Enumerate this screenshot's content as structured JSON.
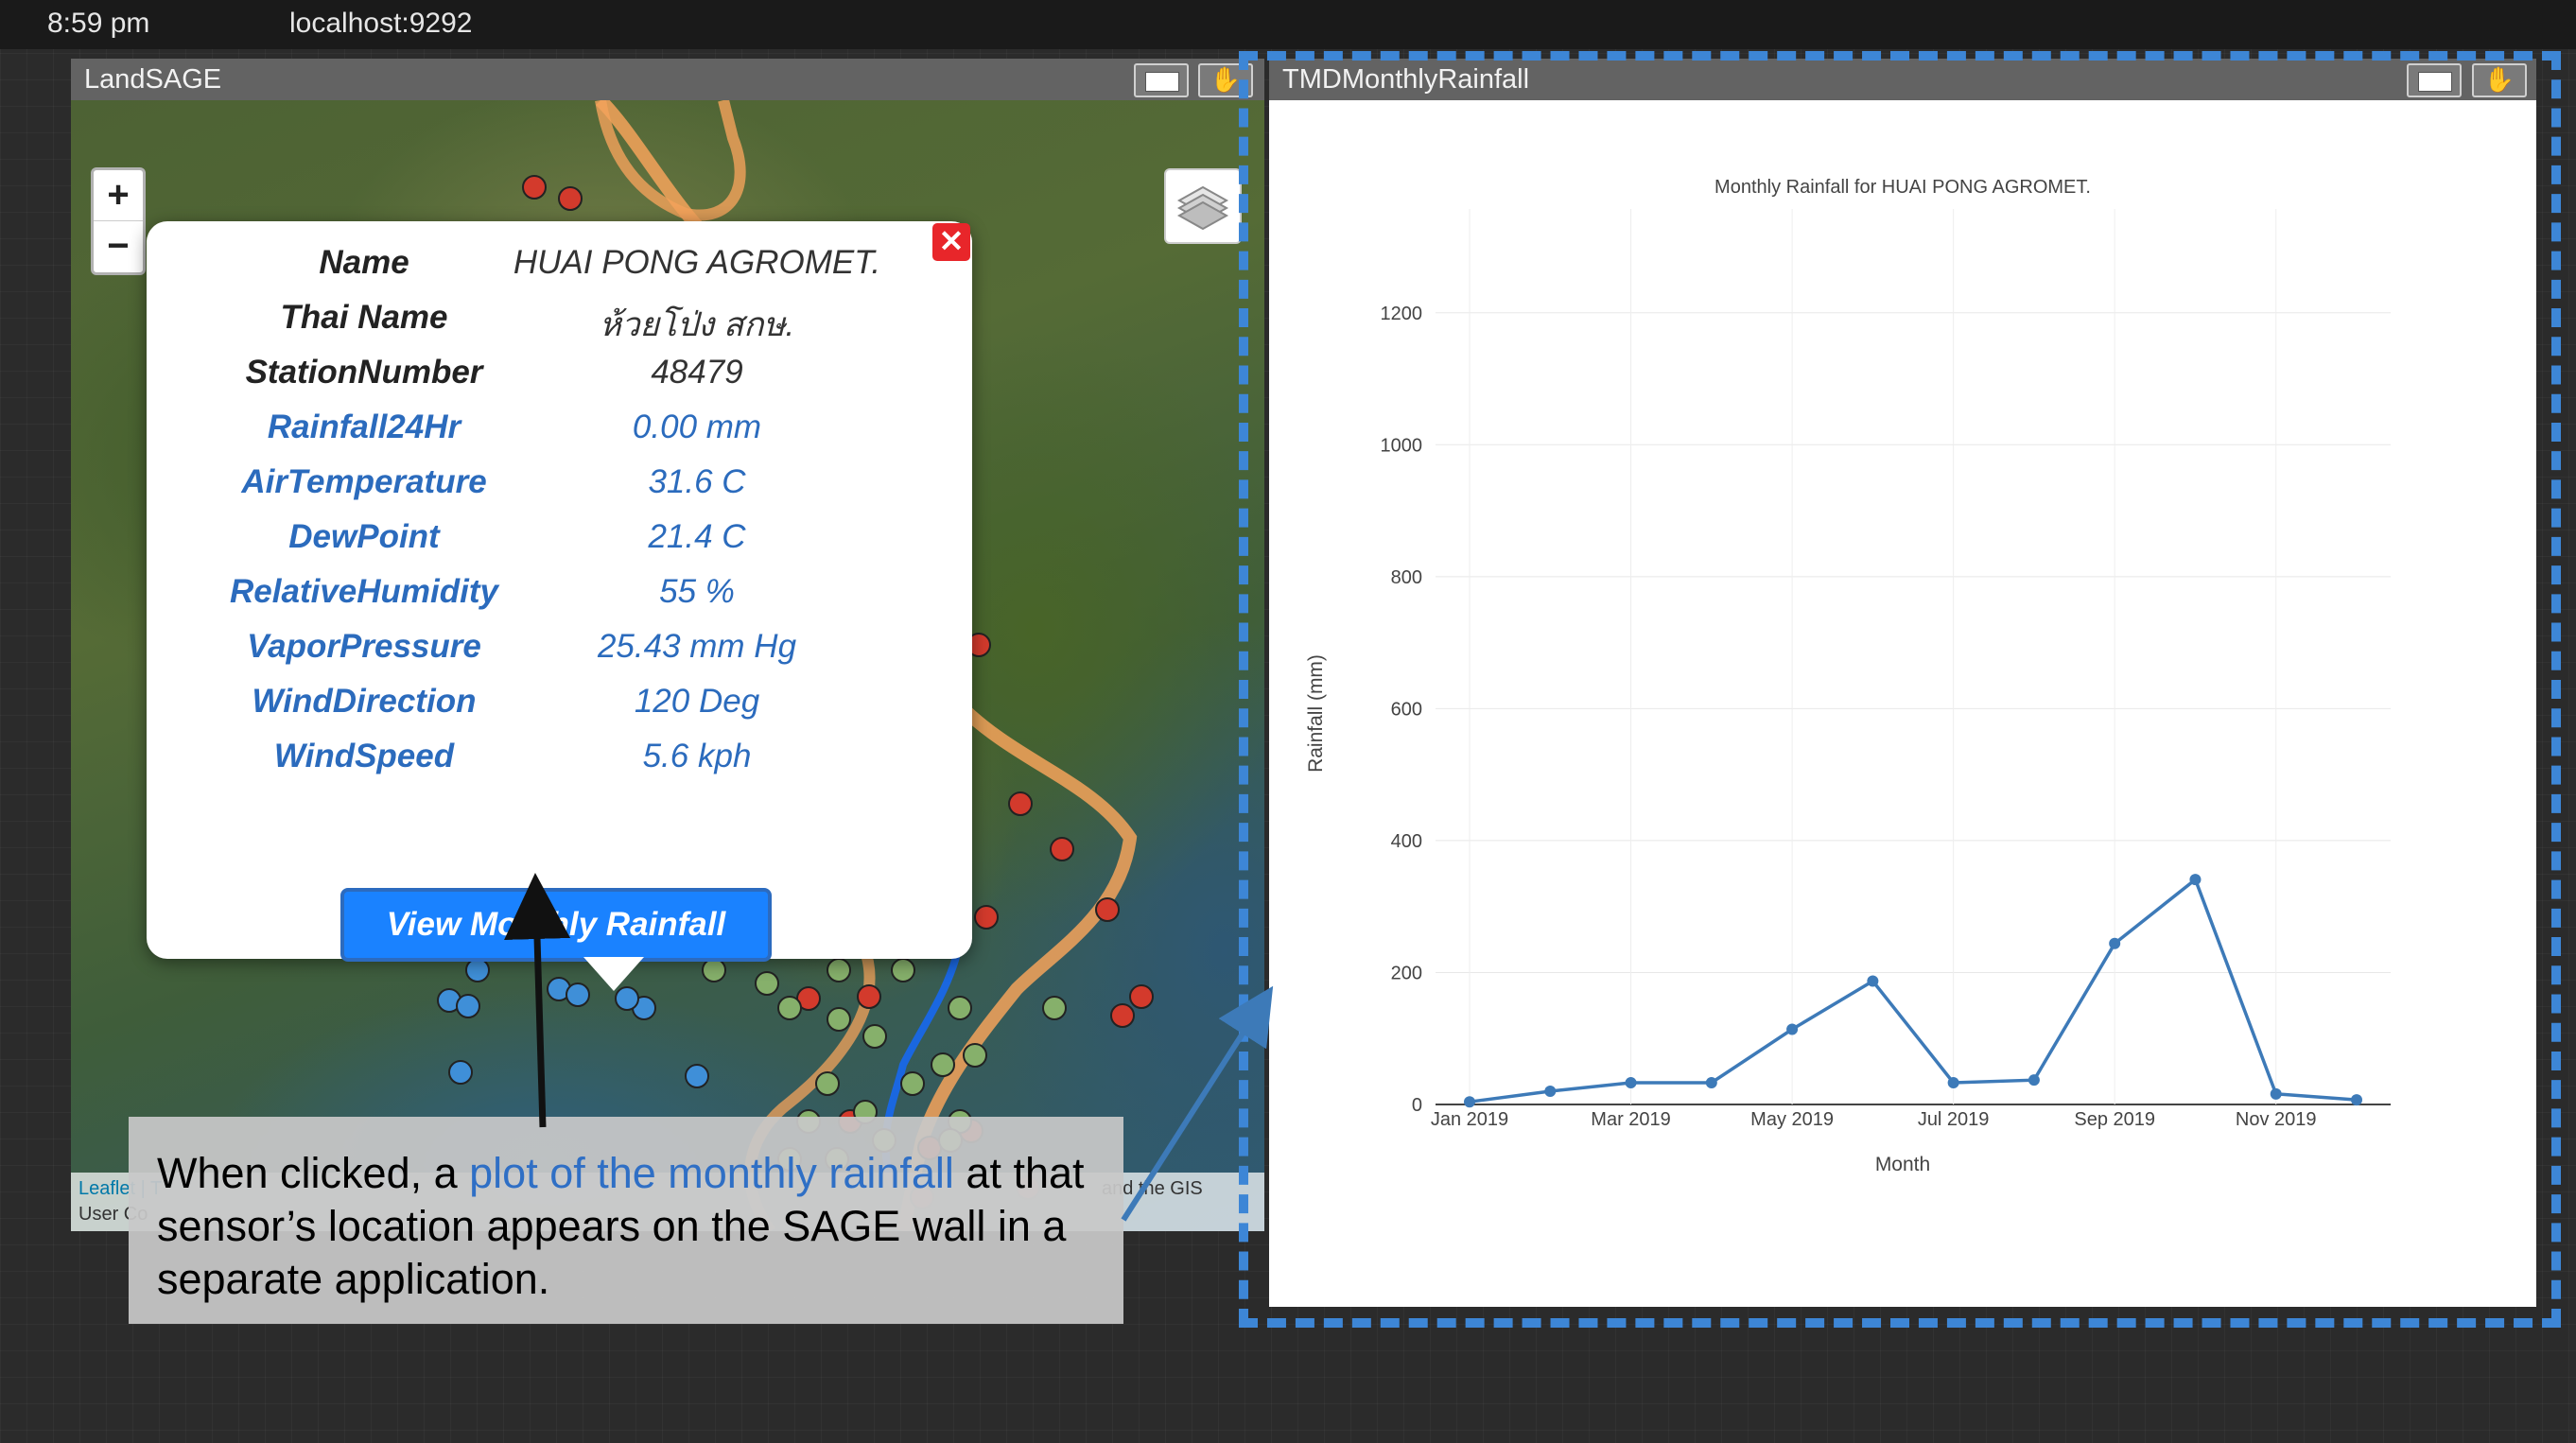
{
  "topbar": {
    "time": "8:59 pm",
    "host": "localhost:9292"
  },
  "map_window": {
    "title": "LandSAGE",
    "zoom_in": "+",
    "zoom_out": "−",
    "attribution_line1": "Leaflet | T",
    "attribution_line1_end": "and the GIS",
    "attribution_line2": "User Co",
    "popup": {
      "close": "✕",
      "rows": [
        {
          "key": "Name",
          "value": "HUAI PONG AGROMET."
        },
        {
          "key": "Thai Name",
          "value": "ห้วยโป่ง สกษ."
        },
        {
          "key": "StationNumber",
          "value": "48479"
        },
        {
          "key": "Rainfall24Hr",
          "value": "0.00 mm"
        },
        {
          "key": "AirTemperature",
          "value": "31.6 C"
        },
        {
          "key": "DewPoint",
          "value": "21.4 C"
        },
        {
          "key": "RelativeHumidity",
          "value": "55 %"
        },
        {
          "key": "VaporPressure",
          "value": "25.43 mm Hg"
        },
        {
          "key": "WindDirection",
          "value": "120 Deg"
        },
        {
          "key": "WindSpeed",
          "value": "5.6 kph"
        }
      ],
      "button": "View Monthly Rainfall"
    },
    "markers_colors": {
      "red": "#d33a2c",
      "green": "#86b06b",
      "blue": "#3f8fd8",
      "boundary": "#f4a35b",
      "river": "#1a67e0"
    }
  },
  "chart_window": {
    "title": "TMDMonthlyRainfall"
  },
  "chart_data": {
    "type": "line",
    "title": "Monthly Rainfall for HUAI PONG AGROMET.",
    "xlabel": "Month",
    "ylabel": "Rainfall (mm)",
    "x": [
      "Jan 2019",
      "Feb 2019",
      "Mar 2019",
      "Apr 2019",
      "May 2019",
      "Jun 2019",
      "Jul 2019",
      "Aug 2019",
      "Sep 2019",
      "Oct 2019",
      "Nov 2019",
      "Dec 2019"
    ],
    "tick_labels": [
      "Jan 2019",
      "Mar 2019",
      "May 2019",
      "Jul 2019",
      "Sep 2019",
      "Nov 2019"
    ],
    "values": [
      4,
      20,
      33,
      33,
      114,
      187,
      33,
      37,
      244,
      341,
      16,
      7
    ],
    "ylim": [
      0,
      1300
    ],
    "yticks": [
      0,
      200,
      400,
      600,
      800,
      1000,
      1200
    ],
    "line_color": "#3d7ab8",
    "grid": true
  },
  "annotation": {
    "part1": "When clicked, a ",
    "highlight": "plot of the monthly rainfall",
    "part2": " at that sensor’s location appears on the SAGE wall in a separate application."
  }
}
